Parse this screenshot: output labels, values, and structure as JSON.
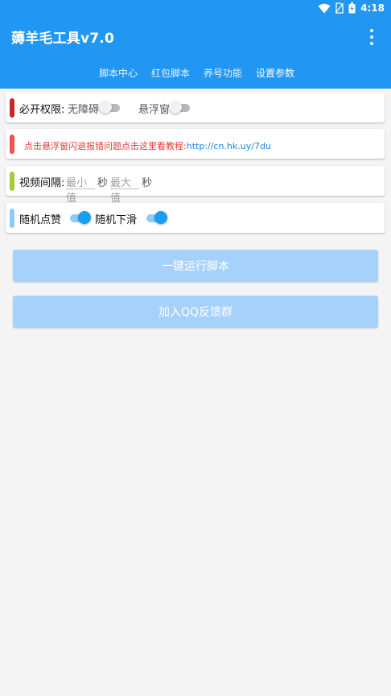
{
  "status": {
    "time": "4:18"
  },
  "app": {
    "title": "薅羊毛工具v7.0"
  },
  "tabs": [
    "脚本中心",
    "红包脚本",
    "养号功能",
    "设置参数"
  ],
  "permissions": {
    "label": "必开权限:",
    "accessibility_label": "无障碍",
    "accessibility_on": false,
    "floating_label": "悬浮窗",
    "floating_on": false
  },
  "notice": {
    "text": "点击悬浮窗闪退报错问题点击这里看教程:",
    "link": "http://cn.hk.uy/7du"
  },
  "video_interval": {
    "label": "视频间隔:",
    "min_placeholder": "最小值",
    "min_unit": "秒",
    "max_placeholder": "最大值",
    "max_unit": "秒"
  },
  "random": {
    "like_label": "随机点赞",
    "like_on": true,
    "swipe_label": "随机下滑",
    "swipe_on": true
  },
  "buttons": {
    "run": "一键运行脚本",
    "join_qq": "加入QQ反馈群"
  },
  "colors": {
    "primary": "#2196f3",
    "button_disabled": "#a6d1fb",
    "notice_red": "#e53935",
    "link_blue": "#1e88e5"
  }
}
